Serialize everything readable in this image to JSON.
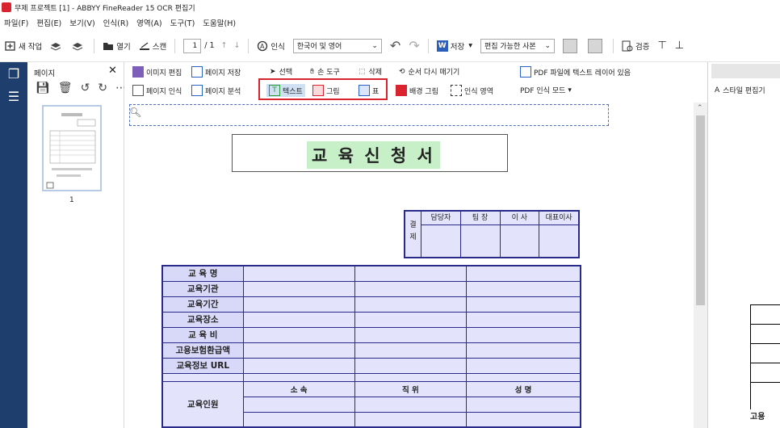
{
  "window": {
    "title": "무제 프로젝트 [1] - ABBYY FineReader 15 OCR 편집기"
  },
  "menu": [
    "파일(F)",
    "편집(E)",
    "보기(V)",
    "인식(R)",
    "영역(A)",
    "도구(T)",
    "도움말(H)"
  ],
  "toolbar": {
    "new_task": "새 작업",
    "open": "열기",
    "scan": "스캔",
    "page_indicator": "1",
    "page_total": "/ 1",
    "recognize": "인식",
    "language": "한국어 및 영어",
    "save": "저장",
    "save_format": "편집 가능한 사본",
    "verify": "검증"
  },
  "pages_panel": {
    "title": "페이지",
    "thumb_number": "1"
  },
  "image_panel": {
    "edit_image": "이미지 편집",
    "save_page": "페이지 저장",
    "select": "선택",
    "hand_tool": "손 도구",
    "delete": "삭제",
    "reorder": "순서 다시 매기기",
    "pdf_text_layer": "PDF 파일에 텍스트 레이어 있음",
    "recognize_page": "페이지 인식",
    "analyze_page": "페이지 분석",
    "text": "텍스트",
    "picture": "그림",
    "table": "표",
    "background_picture": "배경 그림",
    "recognition_area": "인식 영역",
    "pdf_recognition_mode": "PDF 인식 모드"
  },
  "right_panel": {
    "style_editor": "스타일 편집기",
    "partial_label": "고용"
  },
  "document": {
    "title": "교 육 신 청 서",
    "approval": {
      "side_label_1": "결",
      "side_label_2": "제",
      "headers": [
        "담당자",
        "팀 장",
        "이 사",
        "대표이사"
      ]
    },
    "rows": [
      "교 육 명",
      "교육기관",
      "교육기간",
      "교육장소",
      "교 육 비",
      "고용보험환급액",
      "교육정보 URL"
    ],
    "trainee_label": "교육인원",
    "trainee_headers": [
      "소 속",
      "직 위",
      "성 명"
    ]
  },
  "colors": {
    "accent_red": "#d9232e",
    "sidebar_blue": "#1e3f6d",
    "form_fill": "#e3e3fb",
    "title_highlight": "#c8f0c8"
  }
}
